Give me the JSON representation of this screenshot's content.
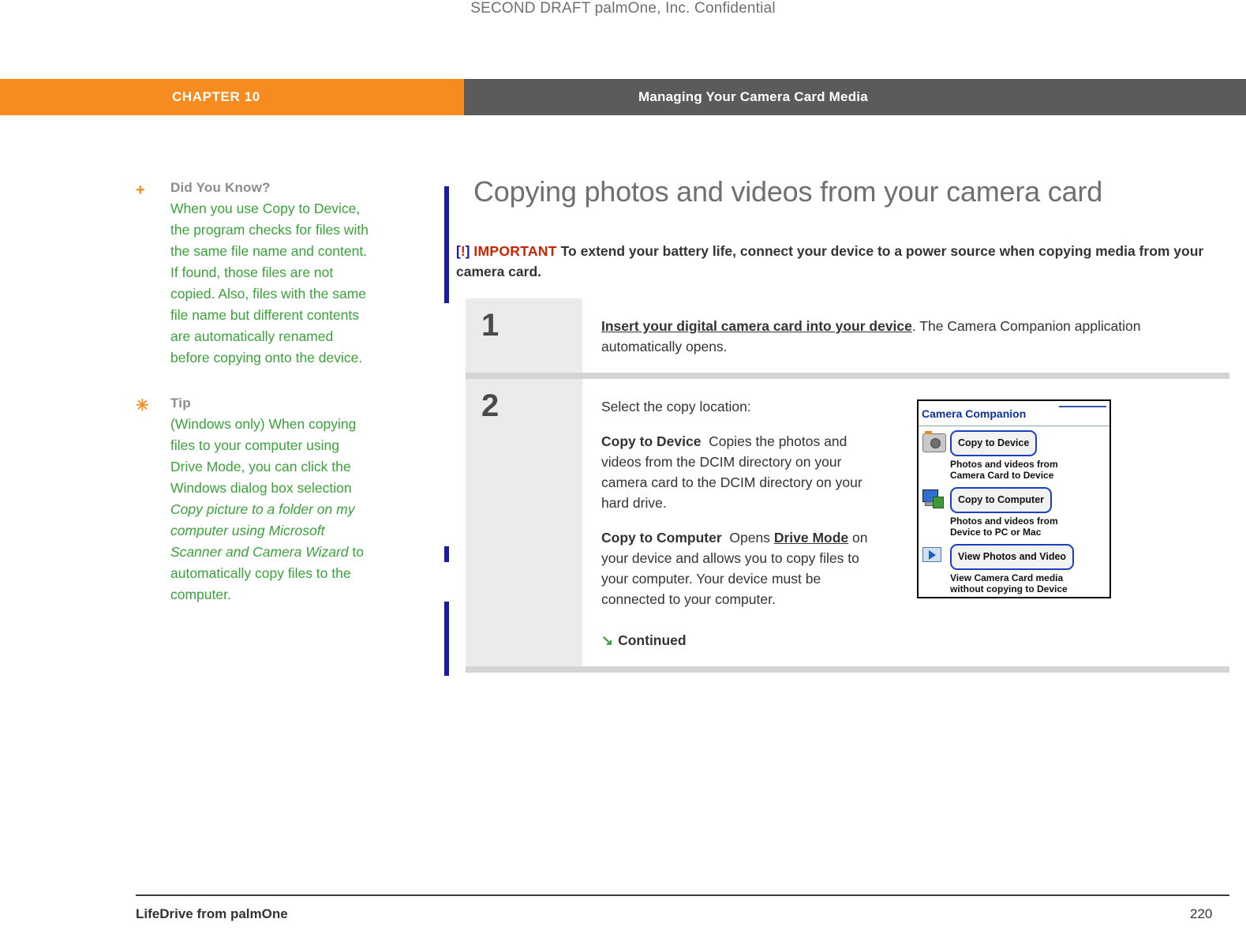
{
  "draft_notice": "SECOND DRAFT palmOne, Inc.  Confidential",
  "chapter": {
    "label": "CHAPTER 10",
    "title": "Managing Your Camera Card Media"
  },
  "sidebar": {
    "notes": [
      {
        "marker": "+",
        "title": "Did You Know?",
        "body": "When you use Copy to Device, the program checks for files with the same file name and content. If found, those files are not copied. Also, files with the same file name but different contents are automatically renamed before copying onto the device."
      },
      {
        "marker": "✳",
        "title": "Tip",
        "body_part1": "(Windows only) When copying files to your computer using Drive Mode, you can click the Windows dialog box selection ",
        "body_italic": "Copy picture to a folder on my computer using Microsoft Scanner and Camera Wizard",
        "body_part2": " to automatically copy files to the computer."
      }
    ]
  },
  "main": {
    "heading": "Copying photos and videos from your camera card",
    "important": {
      "open_bracket": "[",
      "bang": "!",
      "close_bracket": "]",
      "word": "IMPORTANT",
      "text": "To extend your battery life, connect your device to a power source when copying media from your camera card."
    },
    "steps": [
      {
        "number": "1",
        "lead": "Insert your digital camera card into your device",
        "rest": ". The Camera Companion application automatically opens."
      },
      {
        "number": "2",
        "intro": "Select the copy location:",
        "items": [
          {
            "term": "Copy to Device",
            "desc": "Copies the photos and videos from the DCIM directory on your camera card to the DCIM directory on your hard drive."
          },
          {
            "term": "Copy to Computer",
            "desc_pre": "Opens ",
            "desc_link": "Drive Mode",
            "desc_post": " on your device and allows you to copy files to your computer. Your device must be connected to your computer."
          }
        ],
        "continued": "Continued"
      }
    ],
    "camera_companion": {
      "title": "Camera Companion",
      "options": [
        {
          "button": "Copy to Device",
          "line1": "Photos and videos from",
          "line2": "Camera Card to Device"
        },
        {
          "button": "Copy to Computer",
          "line1": "Photos and videos from",
          "line2": "Device to PC or Mac"
        },
        {
          "button": "View Photos and Video",
          "line1": "View Camera Card media",
          "line2": "without copying to Device"
        }
      ]
    }
  },
  "footer": {
    "left": "LifeDrive from palmOne",
    "page": "220"
  },
  "colors": {
    "orange": "#f68b1f",
    "gray_bar": "#5b5b5b",
    "green_text": "#3aa23a",
    "blue_rule": "#1a1aa8",
    "red": "#cc2200"
  }
}
